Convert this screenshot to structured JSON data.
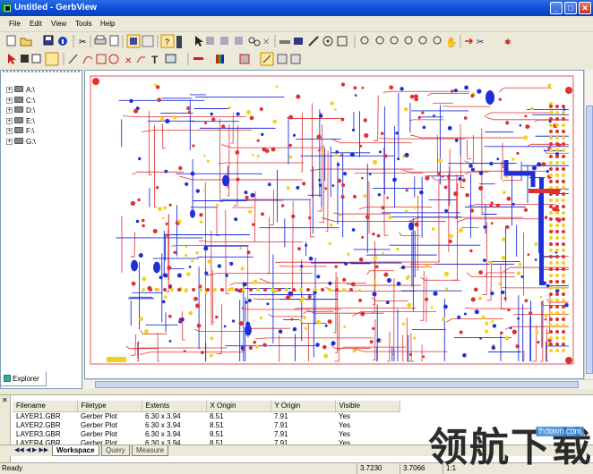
{
  "window": {
    "title": "Untitled - GerbView",
    "min_glyph": "_",
    "max_glyph": "□",
    "close_glyph": "✕"
  },
  "menu": [
    "File",
    "Edit",
    "View",
    "Tools",
    "Help"
  ],
  "explorer": {
    "drives": [
      "A:\\",
      "C:\\",
      "D:\\",
      "E:\\",
      "F:\\",
      "G:\\"
    ],
    "tab_label": "Explorer"
  },
  "layers_panel": {
    "columns": [
      "Filename",
      "Filetype",
      "Extents",
      "X Origin",
      "Y Origin",
      "Visible"
    ],
    "rows": [
      [
        "LAYER1.GBR",
        "Gerber Plot",
        "6.30 x 3.94",
        "8.51",
        "7.91",
        "Yes"
      ],
      [
        "LAYER2.GBR",
        "Gerber Plot",
        "6.30 x 3.94",
        "8.51",
        "7.91",
        "Yes"
      ],
      [
        "LAYER3.GBR",
        "Gerber Plot",
        "6.30 x 3.94",
        "8.51",
        "7.91",
        "Yes"
      ],
      [
        "LAYER4.GBR",
        "Gerber Plot",
        "6.30 x 3.94",
        "8.51",
        "7.91",
        "Yes"
      ]
    ],
    "tabs": [
      "Workspace",
      "Query",
      "Measure"
    ],
    "active_tab": "Workspace"
  },
  "status": {
    "text": "Ready",
    "x": "3.7230",
    "y": "3.7066",
    "scale": "1:1"
  },
  "watermark": {
    "chinese": "领航下载",
    "url": "lhdown.com"
  },
  "colors": {
    "trace_red": "#e03030",
    "trace_blue": "#1f2fd8",
    "pad_yellow": "#f2d21a",
    "board_outline": "#e05555"
  }
}
